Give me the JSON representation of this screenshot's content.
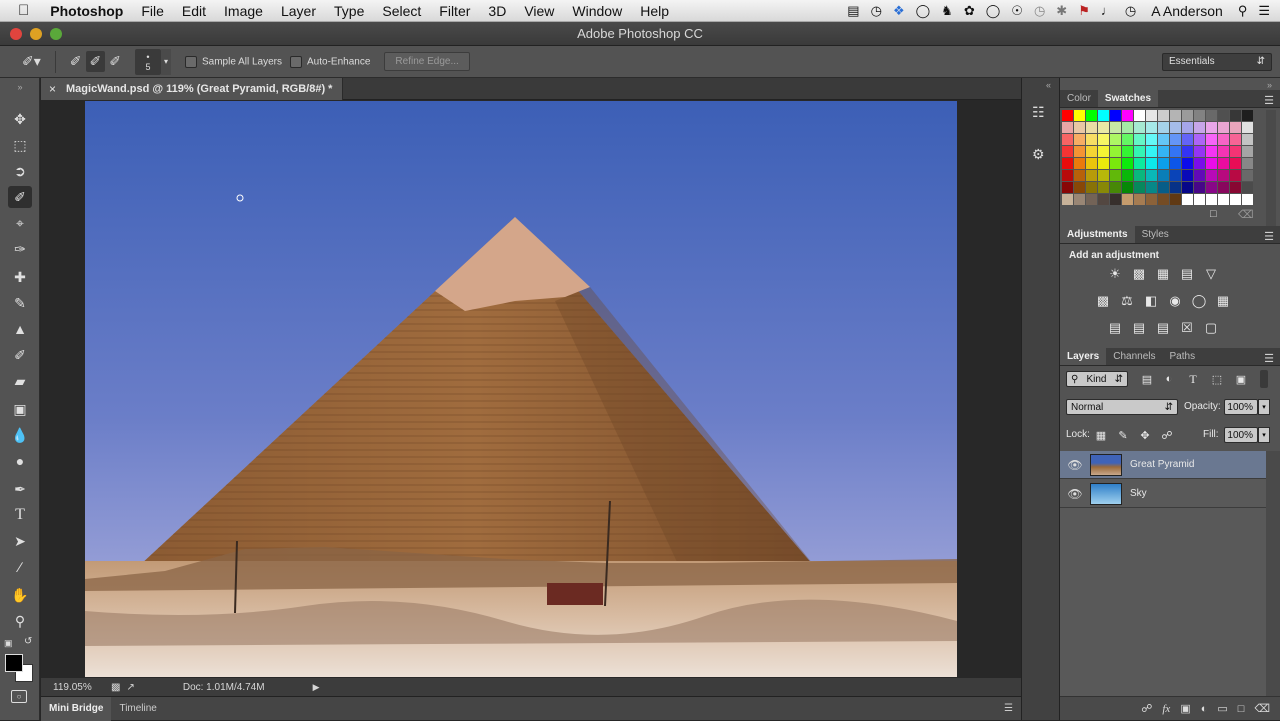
{
  "menubar": {
    "apple": "",
    "app_name": "Photoshop",
    "items": [
      "File",
      "Edit",
      "Image",
      "Layer",
      "Type",
      "Select",
      "Filter",
      "3D",
      "View",
      "Window",
      "Help"
    ],
    "user": "A Anderson"
  },
  "window": {
    "title": "Adobe Photoshop CC"
  },
  "options": {
    "brush_size": "5",
    "sample_all_layers": "Sample All Layers",
    "auto_enhance": "Auto-Enhance",
    "refine_edge": "Refine Edge...",
    "workspace": "Essentials"
  },
  "document": {
    "tab_title": "MagicWand.psd @ 119% (Great Pyramid, RGB/8#) *",
    "zoom": "119.05%",
    "doc_size": "Doc: 1.01M/4.74M"
  },
  "bottom_tabs": [
    "Mini Bridge",
    "Timeline"
  ],
  "panels": {
    "color_tab": "Color",
    "swatches_tab": "Swatches",
    "adjustments_tab": "Adjustments",
    "styles_tab": "Styles",
    "add_adjustment": "Add an adjustment",
    "layers_tab": "Layers",
    "channels_tab": "Channels",
    "paths_tab": "Paths",
    "kind_filter": "Kind",
    "blend_mode": "Normal",
    "opacity_label": "Opacity:",
    "opacity_value": "100%",
    "lock_label": "Lock:",
    "fill_label": "Fill:",
    "fill_value": "100%",
    "layers": [
      {
        "name": "Great Pyramid",
        "selected": true
      },
      {
        "name": "Sky",
        "selected": false
      }
    ]
  },
  "colors": {
    "ui_bg": "#535353",
    "selected_layer": "#6a7891",
    "sky_top": "#3f63b8",
    "sky_bottom": "#8f9ad6",
    "pyramid": "#9a6a3c"
  }
}
